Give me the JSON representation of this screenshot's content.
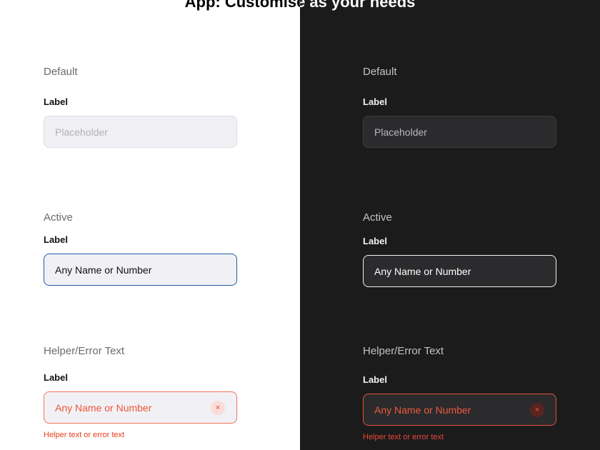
{
  "page": {
    "title": "App: Customise as your needs"
  },
  "light": {
    "default": {
      "title": "Default",
      "label": "Label",
      "placeholder": "Placeholder"
    },
    "active": {
      "title": "Active",
      "label": "Label",
      "value": "Any Name or Number"
    },
    "error": {
      "title": "Helper/Error Text",
      "label": "Label",
      "value": "Any Name or Number",
      "clear_icon": "×",
      "helper": "Helper text or error text"
    }
  },
  "dark": {
    "default": {
      "title": "Default",
      "label": "Label",
      "placeholder": "Placeholder"
    },
    "active": {
      "title": "Active",
      "label": "Label",
      "value": "Any Name or Number"
    },
    "error": {
      "title": "Helper/Error Text",
      "label": "Label",
      "value": "Any Name or Number",
      "clear_icon": "×",
      "helper": "Helper text or error text"
    }
  },
  "colors": {
    "light_background": "#ffffff",
    "dark_background": "#1c1b1c",
    "active_border_light": "#1f5aa8",
    "active_border_dark": "#f4f4f4",
    "error": "#f0553a"
  },
  "icons": {
    "clear": "close-icon"
  }
}
